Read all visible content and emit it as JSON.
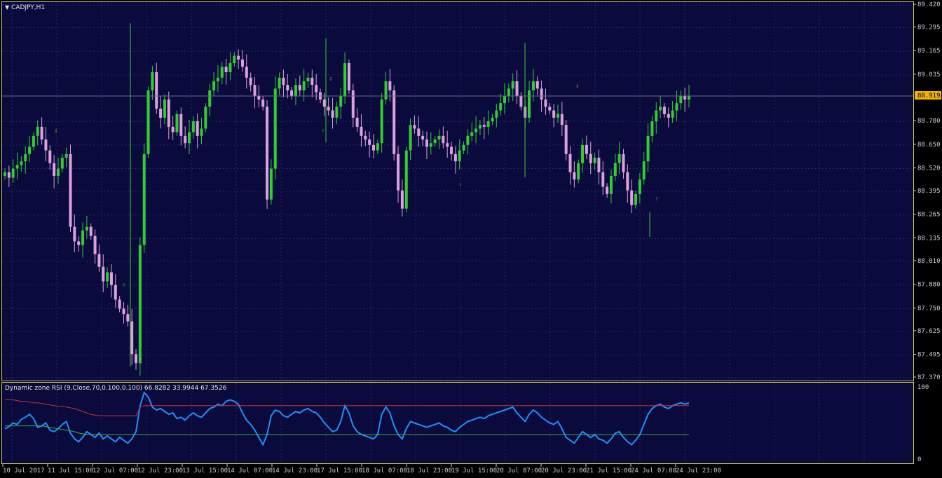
{
  "window": {
    "symbol_label": "CADJPY,H1",
    "menu_icon": "triangle-down-icon"
  },
  "price_axis": {
    "ticks": [
      "89.420",
      "89.295",
      "89.165",
      "89.035",
      "88.780",
      "88.650",
      "88.520",
      "88.395",
      "88.265",
      "88.135",
      "88.010",
      "87.880",
      "87.750",
      "87.625",
      "87.495",
      "87.370"
    ],
    "current_price": "88.919"
  },
  "indicator": {
    "title": "Dynamic zone RSI (9,Close,70,0.100,0.100) 66.8282 33.9944 67.3526",
    "axis_ticks": [
      "100",
      "0"
    ]
  },
  "time_axis": {
    "ticks": [
      "10 Jul 2017",
      "11 Jul 15:00",
      "12 Jul 07:00",
      "12 Jul 23:00",
      "13 Jul 15:00",
      "14 Jul 07:00",
      "14 Jul 23:00",
      "17 Jul 15:00",
      "18 Jul 07:00",
      "18 Jul 23:00",
      "19 Jul 15:00",
      "20 Jul 07:00",
      "20 Jul 23:00",
      "21 Jul 15:00",
      "24 Jul 07:00",
      "24 Jul 23:00"
    ]
  },
  "colors": {
    "background": "#0a0a3c",
    "grid": "#2a2a6a",
    "border": "#c8c864",
    "bull_candle": "#32cd32",
    "bear_candle": "#dda0dd",
    "rsi": "#1e90ff",
    "upper_band": "#c83232",
    "lower_band": "#32b432",
    "price_label_bg": "#f0b400",
    "down_arrow": "#e6a020",
    "up_arrow": "#32b432"
  },
  "chart_data": [
    {
      "type": "candlestick",
      "title": "CADJPY,H1",
      "ylim": [
        87.37,
        89.42
      ],
      "closes": [
        88.5,
        88.47,
        88.52,
        88.54,
        88.56,
        88.6,
        88.64,
        88.7,
        88.75,
        88.68,
        88.62,
        88.55,
        88.48,
        88.52,
        88.58,
        88.6,
        88.2,
        88.12,
        88.1,
        88.18,
        88.2,
        88.15,
        88.05,
        87.98,
        87.9,
        87.95,
        87.88,
        87.8,
        87.75,
        87.72,
        87.68,
        87.5,
        87.45,
        88.1,
        88.6,
        88.95,
        89.05,
        88.85,
        88.8,
        88.9,
        88.75,
        88.72,
        88.82,
        88.7,
        88.66,
        88.72,
        88.78,
        88.7,
        88.74,
        88.86,
        88.95,
        89.0,
        89.02,
        89.08,
        89.05,
        89.1,
        89.14,
        89.12,
        89.08,
        89.02,
        88.98,
        88.92,
        88.9,
        88.86,
        88.35,
        88.52,
        88.96,
        89.02,
        88.98,
        88.95,
        88.92,
        88.98,
        88.95,
        89.0,
        89.02,
        88.98,
        88.94,
        88.9,
        88.86,
        88.84,
        88.8,
        88.86,
        88.92,
        89.1,
        88.95,
        88.8,
        88.75,
        88.7,
        88.68,
        88.65,
        88.62,
        88.66,
        88.9,
        89.0,
        88.95,
        88.6,
        88.4,
        88.3,
        88.62,
        88.76,
        88.74,
        88.7,
        88.68,
        88.64,
        88.66,
        88.68,
        88.7,
        88.66,
        88.64,
        88.6,
        88.56,
        88.62,
        88.65,
        88.7,
        88.72,
        88.74,
        88.76,
        88.75,
        88.78,
        88.8,
        88.84,
        88.88,
        88.92,
        88.96,
        89.0,
        88.92,
        88.86,
        88.8,
        88.95,
        89.0,
        88.96,
        88.9,
        88.86,
        88.84,
        88.8,
        88.82,
        88.76,
        88.6,
        88.5,
        88.46,
        88.55,
        88.65,
        88.6,
        88.55,
        88.58,
        88.5,
        88.42,
        88.38,
        88.48,
        88.55,
        88.6,
        88.5,
        88.4,
        88.32,
        88.38,
        88.46,
        88.56,
        88.7,
        88.78,
        88.84,
        88.86,
        88.82,
        88.8,
        88.84,
        88.88,
        88.92,
        88.9,
        88.92
      ]
    },
    {
      "type": "line",
      "title": "Dynamic zone RSI (9,Close,70,0.100,0.100) 66.8282 33.9944 67.3526",
      "ylim": [
        0,
        100
      ],
      "series": [
        {
          "name": "RSI",
          "values": [
            42,
            45,
            50,
            48,
            55,
            58,
            62,
            56,
            44,
            46,
            50,
            40,
            38,
            42,
            48,
            52,
            36,
            28,
            24,
            30,
            38,
            34,
            30,
            36,
            28,
            32,
            28,
            24,
            30,
            26,
            22,
            28,
            38,
            74,
            92,
            86,
            72,
            68,
            70,
            66,
            62,
            64,
            56,
            58,
            54,
            60,
            64,
            60,
            58,
            64,
            70,
            72,
            76,
            74,
            80,
            82,
            80,
            76,
            64,
            54,
            48,
            40,
            30,
            20,
            34,
            60,
            68,
            66,
            60,
            58,
            62,
            66,
            64,
            68,
            70,
            66,
            64,
            58,
            50,
            44,
            38,
            40,
            52,
            74,
            64,
            46,
            38,
            34,
            32,
            30,
            28,
            34,
            62,
            72,
            64,
            46,
            34,
            28,
            42,
            52,
            50,
            48,
            46,
            44,
            46,
            48,
            50,
            46,
            44,
            40,
            38,
            44,
            48,
            52,
            54,
            56,
            58,
            56,
            60,
            62,
            64,
            66,
            68,
            70,
            72,
            64,
            58,
            52,
            62,
            68,
            64,
            58,
            54,
            50,
            48,
            52,
            42,
            30,
            26,
            22,
            30,
            38,
            34,
            30,
            34,
            28,
            26,
            22,
            28,
            36,
            38,
            30,
            24,
            20,
            26,
            34,
            48,
            62,
            70,
            74,
            76,
            72,
            70,
            74,
            76,
            78,
            76,
            78
          ]
        },
        {
          "name": "Upper",
          "values": [
            82,
            82,
            82,
            81,
            80,
            80,
            79,
            78,
            78,
            77,
            76,
            75,
            74,
            73,
            73,
            72,
            71,
            70,
            68,
            66,
            64,
            62,
            61,
            60,
            60,
            60,
            60,
            60,
            60,
            60,
            60,
            60,
            60,
            72,
            74,
            74,
            74,
            74,
            74,
            74,
            74,
            74,
            74,
            74,
            74,
            74,
            74,
            74,
            74,
            74,
            74,
            74,
            74,
            74,
            74,
            74,
            74,
            74,
            74,
            74,
            74,
            74,
            74,
            74,
            74,
            74,
            74,
            74,
            74,
            74,
            74,
            74,
            74,
            74,
            74,
            74,
            74,
            74,
            74,
            74,
            74,
            74,
            74,
            74,
            74,
            74,
            74,
            74,
            74,
            74,
            74,
            74,
            74,
            74,
            74,
            74,
            74,
            74,
            74,
            74,
            74,
            74,
            74,
            74,
            74,
            74,
            74,
            74,
            74,
            74,
            74,
            74,
            74,
            74,
            74,
            74,
            74,
            74,
            74,
            74,
            74,
            74,
            74,
            74,
            74,
            74,
            74,
            74,
            74,
            74,
            74,
            74,
            74,
            74,
            74,
            74,
            74,
            74,
            74,
            74,
            74,
            74,
            74,
            74,
            74,
            74,
            74,
            74,
            74,
            74,
            74,
            74,
            74,
            74,
            74,
            74,
            74,
            74,
            74,
            74,
            74,
            74,
            74,
            74,
            74,
            74,
            74,
            74
          ]
        },
        {
          "name": "Lower",
          "values": [
            46,
            46,
            46,
            46,
            46,
            46,
            46,
            46,
            46,
            46,
            45,
            44,
            43,
            42,
            41,
            40,
            39,
            38,
            36,
            35,
            34,
            34,
            34,
            34,
            34,
            34,
            34,
            34,
            34,
            34,
            34,
            34,
            34,
            34,
            34,
            34,
            34,
            34,
            34,
            34,
            34,
            34,
            34,
            34,
            34,
            34,
            34,
            34,
            34,
            34,
            34,
            34,
            34,
            34,
            34,
            34,
            34,
            34,
            34,
            34,
            34,
            34,
            34,
            34,
            34,
            34,
            34,
            34,
            34,
            34,
            34,
            34,
            34,
            34,
            34,
            34,
            34,
            34,
            34,
            34,
            34,
            34,
            34,
            34,
            34,
            34,
            34,
            34,
            34,
            34,
            34,
            34,
            34,
            34,
            34,
            34,
            34,
            34,
            34,
            34,
            34,
            34,
            34,
            34,
            34,
            34,
            34,
            34,
            34,
            34,
            34,
            34,
            34,
            34,
            34,
            34,
            34,
            34,
            34,
            34,
            34,
            34,
            34,
            34,
            34,
            34,
            34,
            34,
            34,
            34,
            34,
            34,
            34,
            34,
            34,
            34,
            34,
            34,
            34,
            34,
            34,
            34,
            34,
            34,
            34,
            34,
            34,
            34,
            34,
            34,
            34,
            34,
            34,
            34,
            34,
            34,
            34,
            34,
            34,
            34,
            34,
            34,
            34,
            34,
            34,
            34,
            34,
            34
          ]
        }
      ]
    }
  ]
}
